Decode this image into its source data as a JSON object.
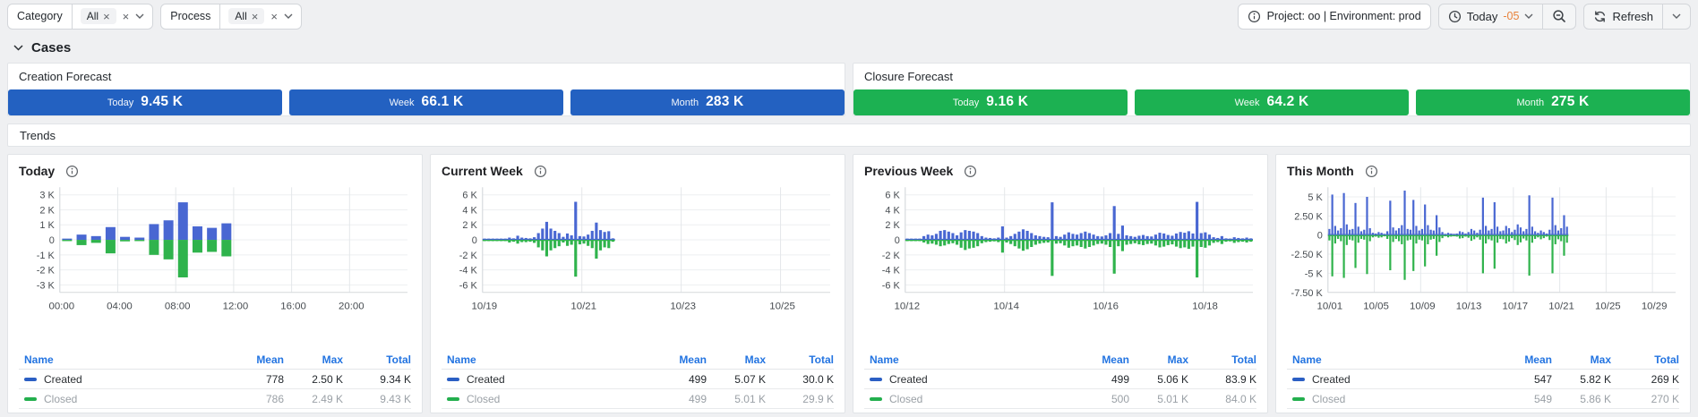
{
  "filter_bar": {
    "filters": [
      {
        "label": "Category",
        "chip": "All"
      },
      {
        "label": "Process",
        "chip": "All"
      }
    ],
    "project_info": "Project: oo | Environment: prod",
    "time_button": {
      "label": "Today",
      "offset": "-05"
    },
    "refresh_label": "Refresh"
  },
  "cases_section": {
    "title": "Cases"
  },
  "forecasts": [
    {
      "title": "Creation Forecast",
      "color": "#2361c1",
      "items": [
        {
          "label": "Today",
          "value": "9.45 K"
        },
        {
          "label": "Week",
          "value": "66.1 K"
        },
        {
          "label": "Month",
          "value": "283 K"
        }
      ]
    },
    {
      "title": "Closure Forecast",
      "color": "#1cb152",
      "items": [
        {
          "label": "Today",
          "value": "9.16 K"
        },
        {
          "label": "Week",
          "value": "64.2 K"
        },
        {
          "label": "Month",
          "value": "275 K"
        }
      ]
    }
  ],
  "trends": {
    "title": "Trends"
  },
  "table_headers": [
    "Name",
    "Mean",
    "Max",
    "Total"
  ],
  "chart_data": [
    {
      "type": "bar",
      "title": "Today",
      "bins": 24,
      "ymax": 3.5,
      "ymin": -3.5,
      "zeroline": false,
      "yticks": [
        {
          "label": "3 K",
          "v": 3
        },
        {
          "label": "2 K",
          "v": 2
        },
        {
          "label": "1 K",
          "v": 1
        },
        {
          "label": "0",
          "v": 0
        },
        {
          "label": "-1 K",
          "v": -1
        },
        {
          "label": "-2 K",
          "v": -2
        },
        {
          "label": "-3 K",
          "v": -3
        }
      ],
      "xticks": [
        {
          "label": "00:00",
          "bin": 0
        },
        {
          "label": "04:00",
          "bin": 4
        },
        {
          "label": "08:00",
          "bin": 8
        },
        {
          "label": "12:00",
          "bin": 12
        },
        {
          "label": "16:00",
          "bin": 16
        },
        {
          "label": "20:00",
          "bin": 20
        }
      ],
      "series": [
        {
          "name": "Created",
          "color": "#4967d2",
          "values": [
            0.05,
            0.35,
            0.25,
            0.85,
            0.2,
            0.15,
            1.05,
            1.3,
            2.5,
            0.9,
            0.8,
            1.1
          ]
        },
        {
          "name": "Closed",
          "color": "#2fb34c",
          "values": [
            0.02,
            0.35,
            0.2,
            0.9,
            0.1,
            0.05,
            1.0,
            1.3,
            2.5,
            0.85,
            0.8,
            1.1
          ]
        }
      ],
      "stats": [
        {
          "name": "Created",
          "color": "#2b5fc4",
          "mean": "778",
          "max": "2.50 K",
          "total": "9.34 K"
        },
        {
          "name": "Closed",
          "color": "#23af4e",
          "mean": "786",
          "max": "2.49 K",
          "total": "9.43 K"
        }
      ]
    },
    {
      "type": "bar",
      "title": "Current Week",
      "bins": 84,
      "ymax": 7,
      "ymin": -7,
      "zeroline": true,
      "yticks": [
        {
          "label": "6 K",
          "v": 6
        },
        {
          "label": "4 K",
          "v": 4
        },
        {
          "label": "2 K",
          "v": 2
        },
        {
          "label": "0",
          "v": 0
        },
        {
          "label": "-2 K",
          "v": -2
        },
        {
          "label": "-4 K",
          "v": -4
        },
        {
          "label": "-6 K",
          "v": -6
        }
      ],
      "xticks": [
        {
          "label": "10/19",
          "bin": 0
        },
        {
          "label": "10/21",
          "bin": 24
        },
        {
          "label": "10/23",
          "bin": 48
        },
        {
          "label": "10/25",
          "bin": 72
        }
      ],
      "series": [
        {
          "name": "Created",
          "color": "#4967d2",
          "values": [
            0.01,
            0.02,
            0.03,
            0.02,
            0.04,
            0.08,
            0.3,
            0.2,
            0.55,
            0.3,
            0.25,
            0.2,
            0.35,
            0.9,
            1.5,
            2.4,
            1.5,
            1.2,
            0.9,
            0.4,
            0.85,
            0.6,
            5.07,
            0.5,
            0.45,
            0.7,
            1.2,
            2.3,
            1.3,
            1.05,
            1.15,
            0.2
          ]
        },
        {
          "name": "Closed",
          "color": "#2fb34c",
          "values": [
            0.01,
            0.02,
            0.02,
            0.03,
            0.05,
            0.1,
            0.35,
            0.25,
            0.5,
            0.3,
            0.3,
            0.25,
            0.4,
            1.0,
            1.4,
            2.2,
            1.4,
            1.1,
            0.85,
            0.35,
            0.8,
            0.65,
            4.9,
            0.6,
            0.5,
            0.8,
            1.1,
            2.5,
            1.4,
            1.0,
            1.1,
            0.25
          ]
        }
      ],
      "stats": [
        {
          "name": "Created",
          "color": "#2b5fc4",
          "mean": "499",
          "max": "5.07 K",
          "total": "30.0 K"
        },
        {
          "name": "Closed",
          "color": "#23af4e",
          "mean": "499",
          "max": "5.01 K",
          "total": "29.9 K"
        }
      ]
    },
    {
      "type": "bar",
      "title": "Previous Week",
      "bins": 84,
      "ymax": 7,
      "ymin": -7,
      "zeroline": true,
      "yticks": [
        {
          "label": "6 K",
          "v": 6
        },
        {
          "label": "4 K",
          "v": 4
        },
        {
          "label": "2 K",
          "v": 2
        },
        {
          "label": "0",
          "v": 0
        },
        {
          "label": "-2 K",
          "v": -2
        },
        {
          "label": "-4 K",
          "v": -4
        },
        {
          "label": "-6 K",
          "v": -6
        }
      ],
      "xticks": [
        {
          "label": "10/12",
          "bin": 0
        },
        {
          "label": "10/14",
          "bin": 24
        },
        {
          "label": "10/16",
          "bin": 48
        },
        {
          "label": "10/18",
          "bin": 72
        }
      ],
      "series": [
        {
          "name": "Created",
          "color": "#4967d2",
          "values": [
            0.05,
            0.03,
            0.04,
            0.1,
            0.5,
            0.7,
            0.6,
            0.8,
            1.2,
            1.3,
            1.1,
            0.9,
            0.6,
            1.0,
            1.3,
            1.2,
            1.1,
            0.9,
            0.5,
            0.3,
            0.25,
            0.2,
            0.3,
            1.8,
            0.3,
            0.5,
            0.8,
            1.1,
            1.4,
            1.2,
            0.9,
            0.6,
            0.5,
            0.4,
            0.35,
            5.0,
            0.5,
            0.4,
            0.7,
            1.0,
            0.8,
            0.7,
            0.9,
            1.1,
            0.9,
            0.7,
            0.5,
            0.45,
            0.6,
            0.9,
            4.5,
            0.8,
            1.9,
            0.6,
            0.5,
            0.4,
            0.55,
            0.65,
            0.5,
            0.45,
            0.7,
            0.95,
            0.85,
            0.65,
            0.55,
            0.85,
            1.05,
            0.95,
            1.15,
            0.85,
            5.06,
            0.9,
            1.0,
            0.7,
            0.35,
            0.25,
            0.5,
            0.2,
            0.15,
            0.35,
            0.25,
            0.2,
            0.3,
            0.2
          ]
        },
        {
          "name": "Closed",
          "color": "#2fb34c",
          "values": [
            0.04,
            0.03,
            0.05,
            0.1,
            0.35,
            0.55,
            0.5,
            0.65,
            0.85,
            0.75,
            0.55,
            0.45,
            0.65,
            1.05,
            1.35,
            1.15,
            1.05,
            0.85,
            0.45,
            0.3,
            0.25,
            0.2,
            0.3,
            1.7,
            0.35,
            0.55,
            0.85,
            1.15,
            1.45,
            1.25,
            0.95,
            0.65,
            0.5,
            0.4,
            0.35,
            4.8,
            0.5,
            0.45,
            0.75,
            1.05,
            0.85,
            0.75,
            0.95,
            1.15,
            0.95,
            0.75,
            0.55,
            0.5,
            0.65,
            0.95,
            4.5,
            0.85,
            1.5,
            0.65,
            0.55,
            0.45,
            0.6,
            0.7,
            0.55,
            0.5,
            0.75,
            1.0,
            0.9,
            0.7,
            0.6,
            0.9,
            1.1,
            1.0,
            1.2,
            0.9,
            5.01,
            0.95,
            1.05,
            0.75,
            0.4,
            0.3,
            0.55,
            0.25,
            0.2,
            0.4,
            0.3,
            0.25,
            0.35,
            0.25
          ]
        }
      ],
      "stats": [
        {
          "name": "Created",
          "color": "#2b5fc4",
          "mean": "499",
          "max": "5.06 K",
          "total": "83.9 K"
        },
        {
          "name": "Closed",
          "color": "#23af4e",
          "mean": "500",
          "max": "5.01 K",
          "total": "84.0 K"
        }
      ]
    },
    {
      "type": "bar",
      "title": "This Month",
      "bins": 120,
      "ymax": 6.25,
      "ymin": -7.5,
      "zeroline": true,
      "yticks": [
        {
          "label": "5 K",
          "v": 5
        },
        {
          "label": "2.50 K",
          "v": 2.5
        },
        {
          "label": "0",
          "v": 0
        },
        {
          "label": "-2.50 K",
          "v": -2.5
        },
        {
          "label": "-5 K",
          "v": -5
        },
        {
          "label": "-7.50 K",
          "v": -7.5
        }
      ],
      "xticks": [
        {
          "label": "10/01",
          "bin": 0
        },
        {
          "label": "10/05",
          "bin": 16
        },
        {
          "label": "10/09",
          "bin": 32
        },
        {
          "label": "10/13",
          "bin": 48
        },
        {
          "label": "10/17",
          "bin": 64
        },
        {
          "label": "10/21",
          "bin": 80
        },
        {
          "label": "10/25",
          "bin": 96
        },
        {
          "label": "10/29",
          "bin": 112
        }
      ],
      "series": [
        {
          "name": "Created",
          "color": "#4967d2",
          "values": [
            0.8,
            5.3,
            1.2,
            0.6,
            0.9,
            5.5,
            1.4,
            0.7,
            0.8,
            4.2,
            1.1,
            0.5,
            0.7,
            5.0,
            0.9,
            0.3,
            0.2,
            0.4,
            0.3,
            0.15,
            0.5,
            4.5,
            1.0,
            0.6,
            0.9,
            1.3,
            5.82,
            0.8,
            0.7,
            4.6,
            1.2,
            0.6,
            0.8,
            4.0,
            1.3,
            0.7,
            0.6,
            2.6,
            1.0,
            0.4,
            0.15,
            0.3,
            0.2,
            0.1,
            0.2,
            0.5,
            0.4,
            0.2,
            0.4,
            0.8,
            0.6,
            0.3,
            0.7,
            4.9,
            1.2,
            0.6,
            0.8,
            4.3,
            1.1,
            0.5,
            0.6,
            1.2,
            0.9,
            0.4,
            0.7,
            1.4,
            1.0,
            0.5,
            0.8,
            5.2,
            1.1,
            0.5,
            0.3,
            0.6,
            0.4,
            0.2,
            0.7,
            4.9,
            1.3,
            0.6,
            0.9,
            2.6,
            1.1
          ]
        },
        {
          "name": "Closed",
          "color": "#2fb34c",
          "values": [
            0.7,
            5.4,
            1.1,
            0.5,
            0.8,
            5.6,
            1.3,
            0.6,
            0.7,
            4.3,
            1.0,
            0.5,
            0.6,
            5.1,
            0.8,
            0.3,
            0.2,
            0.35,
            0.3,
            0.15,
            0.5,
            4.6,
            0.9,
            0.5,
            0.8,
            1.2,
            5.86,
            0.7,
            0.6,
            4.7,
            1.1,
            0.6,
            0.7,
            4.1,
            1.2,
            0.6,
            0.5,
            2.7,
            0.9,
            0.4,
            0.15,
            0.3,
            0.2,
            0.1,
            0.2,
            0.45,
            0.4,
            0.2,
            0.35,
            0.75,
            0.55,
            0.3,
            0.6,
            5.0,
            1.1,
            0.55,
            0.7,
            4.4,
            1.0,
            0.5,
            0.55,
            1.1,
            0.85,
            0.4,
            0.65,
            1.3,
            0.95,
            0.45,
            0.7,
            5.3,
            1.0,
            0.5,
            0.3,
            0.55,
            0.4,
            0.2,
            0.65,
            5.0,
            1.2,
            0.55,
            0.8,
            2.7,
            1.0
          ]
        }
      ],
      "stats": [
        {
          "name": "Created",
          "color": "#2b5fc4",
          "mean": "547",
          "max": "5.82 K",
          "total": "269 K"
        },
        {
          "name": "Closed",
          "color": "#23af4e",
          "mean": "549",
          "max": "5.86 K",
          "total": "270 K"
        }
      ]
    }
  ]
}
